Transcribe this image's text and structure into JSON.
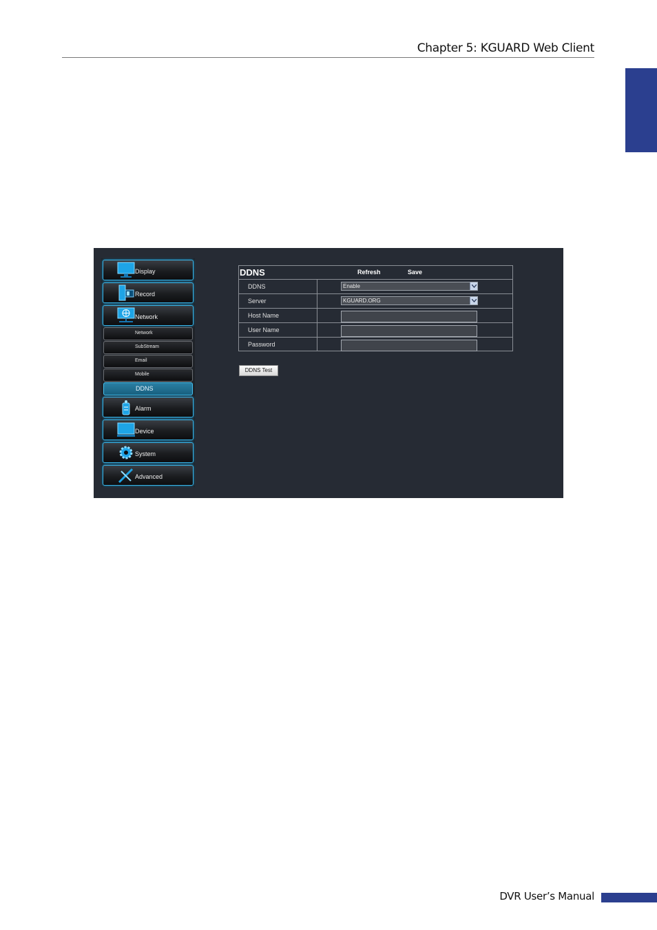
{
  "page": {
    "chapter_title": "Chapter 5: KGUARD Web Client",
    "footer_text": "DVR User’s Manual"
  },
  "menu": {
    "main_top": [
      {
        "label": "Display",
        "icon": "monitor-icon"
      },
      {
        "label": "Record",
        "icon": "record-icon"
      },
      {
        "label": "Network",
        "icon": "network-globe-icon"
      }
    ],
    "sub_items": [
      {
        "label": "Network",
        "active": false
      },
      {
        "label": "SubStream",
        "active": false
      },
      {
        "label": "Email",
        "active": false
      },
      {
        "label": "Mobile",
        "active": false
      },
      {
        "label": "DDNS",
        "active": true
      }
    ],
    "main_bottom": [
      {
        "label": "Alarm",
        "icon": "alarm-icon"
      },
      {
        "label": "Device",
        "icon": "device-icon"
      },
      {
        "label": "System",
        "icon": "gear-icon"
      },
      {
        "label": "Advanced",
        "icon": "tools-icon"
      }
    ]
  },
  "ddns": {
    "title": "DDNS",
    "refresh_label": "Refresh",
    "save_label": "Save",
    "fields": {
      "ddns": {
        "label": "DDNS",
        "value": "Enable"
      },
      "server": {
        "label": "Server",
        "value": "KGUARD.ORG"
      },
      "host_name": {
        "label": "Host Name",
        "value": ""
      },
      "user_name": {
        "label": "User Name",
        "value": ""
      },
      "password": {
        "label": "Password",
        "value": ""
      }
    },
    "test_button_label": "DDNS Test"
  },
  "colors": {
    "accent_blue": "#2b3f8f",
    "panel_bg": "#262b34",
    "glow": "#39b3e6"
  }
}
